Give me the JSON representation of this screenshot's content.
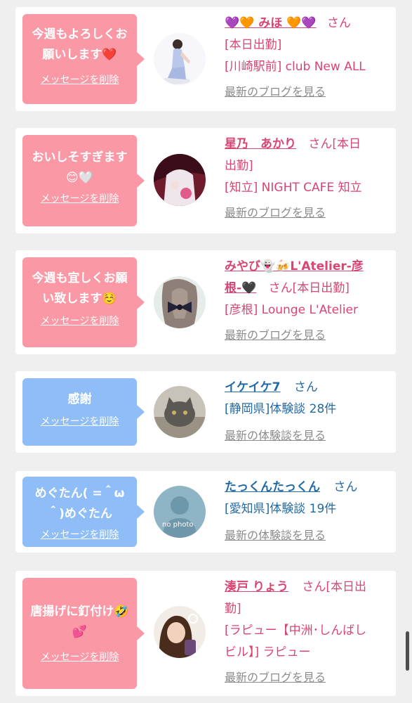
{
  "delete_label": "メッセージを削除",
  "colors": {
    "pink_bubble": "#fa98a6",
    "blue_bubble": "#8fbdf7",
    "pink_text": "#d94571",
    "blue_text": "#236aa5",
    "link_gray": "#8b8b8b"
  },
  "cards": [
    {
      "message_lines": [
        "今週もよろしくお",
        "願いします❤️"
      ],
      "name": "💜🧡 みほ 🧡💜",
      "san": "さん",
      "lines": [
        "[本日出勤]",
        "[川崎駅前] club New ALL"
      ],
      "link": "最新のブログを見る"
    },
    {
      "message_lines": [
        "おいしそすぎます",
        "😊🤍"
      ],
      "name": "星乃　あかり",
      "san": "さん[本日",
      "lines": [
        "出勤]",
        "[知立] NIGHT CAFE 知立"
      ],
      "link": "最新のブログを見る"
    },
    {
      "message_lines": [
        "今週も宜しくお願",
        "い致します☺️"
      ],
      "name": "みやび👻🍻L'Atelier-彦",
      "name2": "根-🖤",
      "san": "さん[本日出勤]",
      "lines": [
        "[彦根] Lounge L'Atelier"
      ],
      "link": "最新のブログを見る"
    },
    {
      "message_lines": [
        "感謝"
      ],
      "name": "イケイケ7",
      "san": "さん",
      "lines": [
        "[静岡県]体験談 28件"
      ],
      "link": "最新の体験談を見る"
    },
    {
      "message_lines": [
        "めぐたん( =＾ω",
        "＾)めぐたん"
      ],
      "name": "たっくんたっくん",
      "san": "さん",
      "lines": [
        "[愛知県]体験談 19件"
      ],
      "link": "最新の体験談を見る",
      "avatar_text": "no photo"
    },
    {
      "message_lines": [
        "唐揚げに釘付け🤣",
        "💕"
      ],
      "name": "湊戸 りょう",
      "san": "さん[本日出",
      "lines": [
        "勤]",
        "[ラピュー【中洲･しんばし",
        "ビル】] ラピュー"
      ],
      "link": "最新のブログを見る"
    }
  ]
}
